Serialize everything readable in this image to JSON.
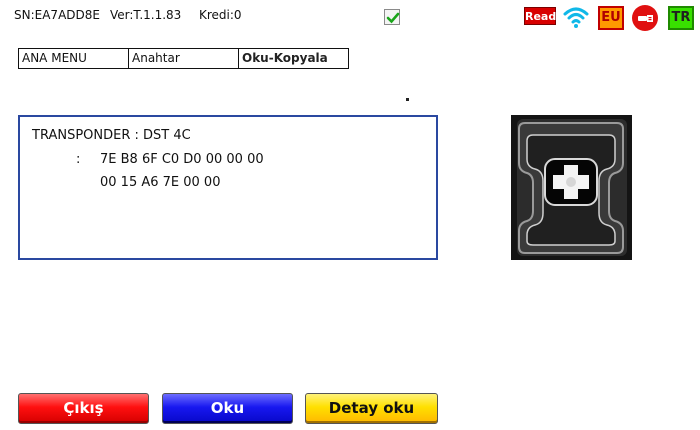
{
  "status_bar": {
    "serial": "SN:EA7ADD8E",
    "version": "Ver:T.1.1.83",
    "credit": "Kredi:0",
    "checkbox_checked": true,
    "read_badge": "Read",
    "region_badge": "EU",
    "language_badge": "TR",
    "icons": [
      "wifi-icon",
      "usb-icon"
    ]
  },
  "breadcrumb": {
    "items": [
      "ANA MENU",
      "Anahtar",
      "Oku-Kopyala"
    ]
  },
  "transponder": {
    "title": "TRANSPONDER : DST 4C",
    "colon": ":",
    "data_line_1": "7E B8 6F C0 D0 00 00 00",
    "data_line_2": "00 15 A6 7E 00 00"
  },
  "buttons": {
    "exit": "Çıkış",
    "read": "Oku",
    "detail": "Detay oku"
  },
  "colors": {
    "panel_border": "#2a48a0",
    "exit_button": "#ff1010",
    "read_button": "#1818f0",
    "detail_button": "#ffe000"
  }
}
